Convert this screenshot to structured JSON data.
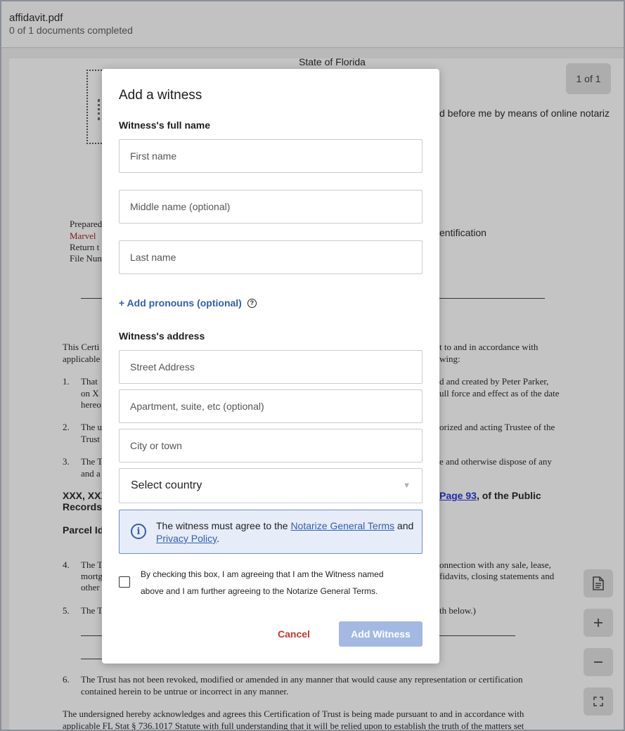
{
  "header": {
    "file_name": "affidavit.pdf",
    "status": "0 of 1 documents completed"
  },
  "document": {
    "page_indicator": "1 of 1",
    "lines": {
      "state": "State of Florida",
      "notariz": "d before me by means of online notariz",
      "prepared": "Prepared",
      "marvel": "Marvel",
      "certification": "entification",
      "return": "Return t",
      "filenum": "File Nun",
      "p1a": "This Certi",
      "p1b": "applicable",
      "p1c": "t to and in accordance with",
      "p1d": "wing:",
      "i1": "1.",
      "i1a": "That",
      "i1b": "on X",
      "i1c": "hereo",
      "i1d": "d and created by Peter Parker,",
      "i1e": "ull force and effect as of the date",
      "i2": "2.",
      "i2a": "The u",
      "i2b": "Trust",
      "i2c": "orized and acting Trustee of the",
      "i3": "3.",
      "i3a": "The T",
      "i3b": "and a",
      "i3c": "e and otherwise dispose of any",
      "xxx": "XXX, XXX",
      "records": "Records",
      "page93": "Page 93",
      "public": ", of the Public",
      "parcel": "Parcel Id",
      "i4": "4.",
      "i4a": "The T",
      "i4b": "mortg",
      "i4c": "other",
      "i4d": "onnection with any sale, lease,",
      "i4e": "fidavits, closing statements and",
      "i5": "5.",
      "i5a": "The T",
      "i5b": "th below.)",
      "i6": "6.",
      "i6a": "The Trust has not been revoked, modified or amended in any manner that would cause any representation or certification",
      "i6b": "contained herein to be untrue or incorrect in any manner.",
      "f1": "The undersigned hereby acknowledges and agrees this Certification of Trust is being made pursuant to and in accordance with",
      "f2": "applicable FL Stat § 736.1017  Statute with full understanding that it will be relied upon to establish the truth of the matters set"
    }
  },
  "tools": {
    "document_icon": "document-icon",
    "zoom_in_icon": "plus-icon",
    "zoom_out_icon": "minus-icon",
    "fullscreen_icon": "expand-icon"
  },
  "modal": {
    "title": "Add a witness",
    "name_section_label": "Witness's full name",
    "first_name_placeholder": "First name",
    "middle_name_placeholder": "Middle name (optional)",
    "last_name_placeholder": "Last name",
    "add_pronouns_label": "+ Add pronouns (optional)",
    "help_glyph": "?",
    "address_section_label": "Witness's address",
    "street_placeholder": "Street Address",
    "apartment_placeholder": "Apartment, suite, etc (optional)",
    "city_placeholder": "City or town",
    "country_selected": "Select country",
    "info": {
      "prefix": "The witness must agree to the ",
      "terms_link": "Notarize General Terms",
      "middle": " and ",
      "privacy_link": "Privacy Policy",
      "suffix": "."
    },
    "agreement_text": "By checking this box, I am agreeing that I am the Witness named above and I am further agreeing to the Notarize General Terms.",
    "cancel_label": "Cancel",
    "submit_label": "Add Witness"
  },
  "colors": {
    "accent": "#2f5fb3",
    "cancel": "#c0392b",
    "submit_disabled": "#a3b9e3",
    "info_bg": "#e6ecf8"
  }
}
